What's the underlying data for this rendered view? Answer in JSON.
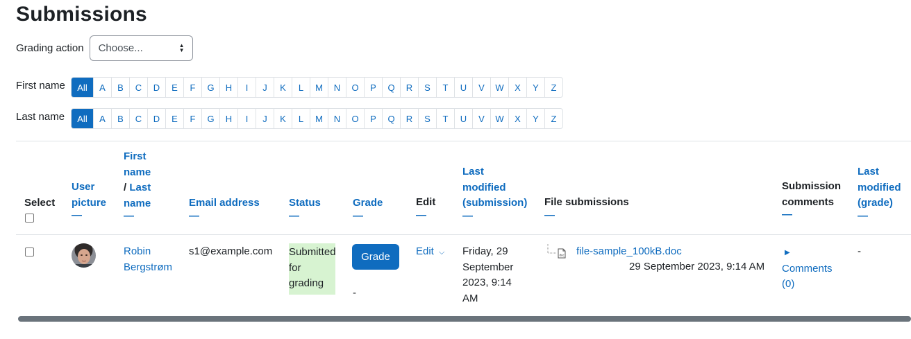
{
  "page": {
    "title": "Submissions"
  },
  "grading_action": {
    "label": "Grading action",
    "selected": "Choose..."
  },
  "initials_filter": {
    "first_name_label": "First name",
    "last_name_label": "Last name",
    "letters": [
      "All",
      "A",
      "B",
      "C",
      "D",
      "E",
      "F",
      "G",
      "H",
      "I",
      "J",
      "K",
      "L",
      "M",
      "N",
      "O",
      "P",
      "Q",
      "R",
      "S",
      "T",
      "U",
      "V",
      "W",
      "X",
      "Y",
      "Z"
    ]
  },
  "table": {
    "headers": {
      "select": "Select",
      "user_picture_1": "User",
      "user_picture_2": "picture",
      "first_name_1": "First",
      "first_name_2": "name",
      "name_sep": "/ ",
      "last_name_1": "Last",
      "last_name_2": "name",
      "email": "Email address",
      "status": "Status",
      "grade": "Grade",
      "edit": "Edit",
      "last_modified_sub_1": "Last",
      "last_modified_sub_2": "modified",
      "last_modified_sub_3": "(submission)",
      "file_submissions": "File submissions",
      "submission_comments_1": "Submission",
      "submission_comments_2": "comments",
      "last_modified_grade_1": "Last",
      "last_modified_grade_2": "modified",
      "last_modified_grade_3": "(grade)",
      "collapse_symbol": "—"
    },
    "row": {
      "first_name": "Robin",
      "last_name": "Bergstrøm",
      "email": "s1@example.com",
      "status_1": "Submitted",
      "status_2": "for",
      "status_3": "grading",
      "grade_button": "Grade",
      "grade_value": "-",
      "edit_label": "Edit",
      "modified_1": "Friday, 29",
      "modified_2": "September",
      "modified_3": "2023, 9:14",
      "modified_4": "AM",
      "file_name": "file-sample_100kB.doc",
      "file_date": "29 September 2023, 9:14 AM",
      "comments_label": "Comments",
      "comments_count": "(0)",
      "last_modified_grade": "-"
    }
  }
}
